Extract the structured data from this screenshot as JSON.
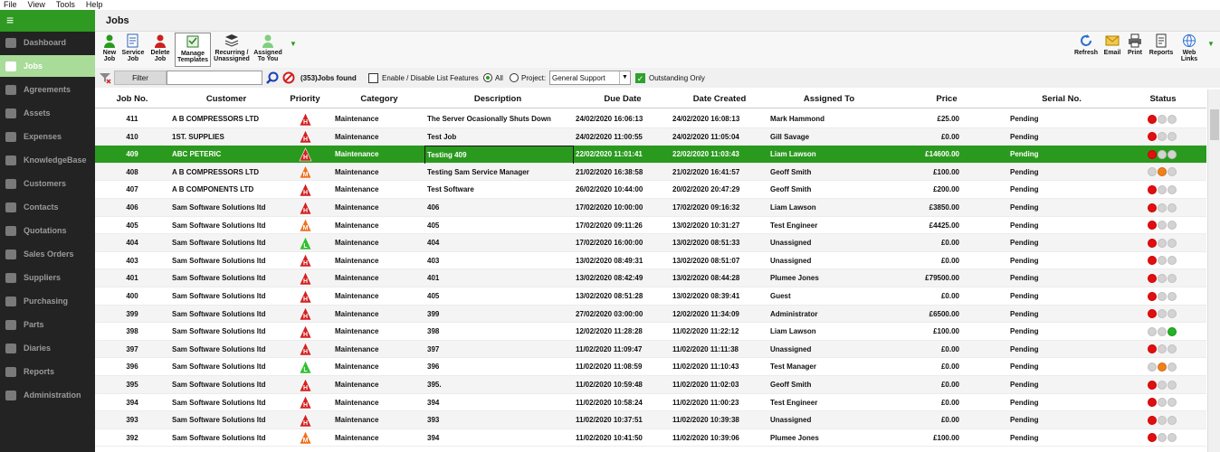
{
  "menu": [
    "File",
    "View",
    "Tools",
    "Help"
  ],
  "sidebar": {
    "toggle_glyph": "≡",
    "items": [
      {
        "label": "Dashboard",
        "icon": "dashboard-icon"
      },
      {
        "label": "Jobs",
        "icon": "pencil-icon",
        "active": true
      },
      {
        "label": "Agreements",
        "icon": "agreements-icon"
      },
      {
        "label": "Assets",
        "icon": "excel-icon"
      },
      {
        "label": "Expenses",
        "icon": "expenses-icon"
      },
      {
        "label": "KnowledgeBase",
        "icon": "knowledgebase-icon"
      },
      {
        "label": "Customers",
        "icon": "person-icon"
      },
      {
        "label": "Contacts",
        "icon": "phone-icon"
      },
      {
        "label": "Quotations",
        "icon": "quotation-icon"
      },
      {
        "label": "Sales Orders",
        "icon": "sales-icon"
      },
      {
        "label": "Suppliers",
        "icon": "box-icon"
      },
      {
        "label": "Purchasing",
        "icon": "purchasing-icon"
      },
      {
        "label": "Parts",
        "icon": "parts-icon"
      },
      {
        "label": "Diaries",
        "icon": "calendar-icon"
      },
      {
        "label": "Reports",
        "icon": "reports-icon"
      },
      {
        "label": "Administration",
        "icon": "wrench-icon"
      }
    ]
  },
  "page": {
    "title": "Jobs"
  },
  "toolbar": {
    "left": [
      {
        "label1": "New",
        "label2": "Job",
        "icon": "new-job-icon"
      },
      {
        "label1": "Service",
        "label2": "Job",
        "icon": "service-job-icon"
      },
      {
        "label1": "Delete",
        "label2": "Job",
        "icon": "delete-job-icon"
      },
      {
        "label1": "Manage",
        "label2": "Templates",
        "icon": "templates-icon"
      },
      {
        "label1": "Recurring /",
        "label2": "Unassigned",
        "icon": "recurring-icon"
      },
      {
        "label1": "Assigned",
        "label2": "To You",
        "icon": "assigned-icon"
      }
    ],
    "right": [
      {
        "label1": "Refresh",
        "label2": "",
        "icon": "refresh-icon"
      },
      {
        "label1": "Email",
        "label2": "",
        "icon": "email-icon"
      },
      {
        "label1": "Print",
        "label2": "",
        "icon": "print-icon"
      },
      {
        "label1": "Reports",
        "label2": "",
        "icon": "reports-icon"
      },
      {
        "label1": "Web",
        "label2": "Links",
        "icon": "web-links-icon"
      }
    ]
  },
  "filter": {
    "button": "Filter",
    "search_value": "",
    "jobs_found": "(353)Jobs found",
    "list_features": "Enable / Disable List Features",
    "radio_all": "All",
    "radio_project": "Project:",
    "project_value": "General Support",
    "outstanding": "Outstanding Only"
  },
  "table": {
    "headers": [
      "Job No.",
      "Customer",
      "Priority",
      "Category",
      "Description",
      "Due Date",
      "Date Created",
      "Assigned To",
      "Price",
      "Serial No.",
      "Status"
    ],
    "rows": [
      {
        "job": "411",
        "customer": "A B COMPRESSORS LTD",
        "priority": "H",
        "category": "Maintenance",
        "description": "The Server Ocasionally Shuts Down",
        "due": "24/02/2020 16:06:13",
        "created": "24/02/2020 16:08:13",
        "assigned": "Mark Hammond",
        "price": "£25.00",
        "serial": "Pending",
        "status": [
          "red",
          "grey",
          "grey"
        ]
      },
      {
        "job": "410",
        "customer": "1ST. SUPPLIES",
        "priority": "H",
        "category": "Maintenance",
        "description": "Test Job",
        "due": "24/02/2020 11:00:55",
        "created": "24/02/2020 11:05:04",
        "assigned": "Gill Savage",
        "price": "£0.00",
        "serial": "Pending",
        "status": [
          "red",
          "grey",
          "grey"
        ]
      },
      {
        "job": "409",
        "customer": "ABC PETERIC",
        "priority": "H",
        "category": "Maintenance",
        "description": "Testing 409",
        "due": "22/02/2020 11:01:41",
        "created": "22/02/2020 11:03:43",
        "assigned": "Liam Lawson",
        "price": "£14600.00",
        "serial": "Pending",
        "status": [
          "red",
          "grey",
          "grey"
        ],
        "selected": true
      },
      {
        "job": "408",
        "customer": "A B COMPRESSORS LTD",
        "priority": "M",
        "category": "Maintenance",
        "description": "Testing Sam Service Manager",
        "due": "21/02/2020 16:38:58",
        "created": "21/02/2020 16:41:57",
        "assigned": "Geoff Smith",
        "price": "£100.00",
        "serial": "Pending",
        "status": [
          "grey",
          "orange",
          "grey"
        ]
      },
      {
        "job": "407",
        "customer": "A B COMPONENTS LTD",
        "priority": "H",
        "category": "Maintenance",
        "description": "Test Software",
        "due": "26/02/2020 10:44:00",
        "created": "20/02/2020 20:47:29",
        "assigned": "Geoff Smith",
        "price": "£200.00",
        "serial": "Pending",
        "status": [
          "red",
          "grey",
          "grey"
        ]
      },
      {
        "job": "406",
        "customer": "Sam Software Solutions ltd",
        "priority": "H",
        "category": "Maintenance",
        "description": "406",
        "due": "17/02/2020 10:00:00",
        "created": "17/02/2020 09:16:32",
        "assigned": "Liam Lawson",
        "price": "£3850.00",
        "serial": "Pending",
        "status": [
          "red",
          "grey",
          "grey"
        ]
      },
      {
        "job": "405",
        "customer": "Sam Software Solutions ltd",
        "priority": "M",
        "category": "Maintenance",
        "description": "405",
        "due": "17/02/2020 09:11:26",
        "created": "13/02/2020 10:31:27",
        "assigned": "Test Engineer",
        "price": "£4425.00",
        "serial": "Pending",
        "status": [
          "red",
          "grey",
          "grey"
        ]
      },
      {
        "job": "404",
        "customer": "Sam Software Solutions ltd",
        "priority": "L",
        "category": "Maintenance",
        "description": "404",
        "due": "17/02/2020 16:00:00",
        "created": "13/02/2020 08:51:33",
        "assigned": "Unassigned",
        "price": "£0.00",
        "serial": "Pending",
        "status": [
          "red",
          "grey",
          "grey"
        ]
      },
      {
        "job": "403",
        "customer": "Sam Software Solutions ltd",
        "priority": "H",
        "category": "Maintenance",
        "description": "403",
        "due": "13/02/2020 08:49:31",
        "created": "13/02/2020 08:51:07",
        "assigned": "Unassigned",
        "price": "£0.00",
        "serial": "Pending",
        "status": [
          "red",
          "grey",
          "grey"
        ]
      },
      {
        "job": "401",
        "customer": "Sam Software Solutions ltd",
        "priority": "H",
        "category": "Maintenance",
        "description": "401",
        "due": "13/02/2020 08:42:49",
        "created": "13/02/2020 08:44:28",
        "assigned": "Plumee Jones",
        "price": "£79500.00",
        "serial": "Pending",
        "status": [
          "red",
          "grey",
          "grey"
        ]
      },
      {
        "job": "400",
        "customer": "Sam Software Solutions ltd",
        "priority": "H",
        "category": "Maintenance",
        "description": "405",
        "due": "13/02/2020 08:51:28",
        "created": "13/02/2020 08:39:41",
        "assigned": "Guest",
        "price": "£0.00",
        "serial": "Pending",
        "status": [
          "red",
          "grey",
          "grey"
        ]
      },
      {
        "job": "399",
        "customer": "Sam Software Solutions ltd",
        "priority": "H",
        "category": "Maintenance",
        "description": "399",
        "due": "27/02/2020 03:00:00",
        "created": "12/02/2020 11:34:09",
        "assigned": "Administrator",
        "price": "£6500.00",
        "serial": "Pending",
        "status": [
          "red",
          "grey",
          "grey"
        ]
      },
      {
        "job": "398",
        "customer": "Sam Software Solutions ltd",
        "priority": "H",
        "category": "Maintenance",
        "description": "398",
        "due": "12/02/2020 11:28:28",
        "created": "11/02/2020 11:22:12",
        "assigned": "Liam Lawson",
        "price": "£100.00",
        "serial": "Pending",
        "status": [
          "grey",
          "grey",
          "green"
        ]
      },
      {
        "job": "397",
        "customer": "Sam Software Solutions ltd",
        "priority": "H",
        "category": "Maintenance",
        "description": "397",
        "due": "11/02/2020 11:09:47",
        "created": "11/02/2020 11:11:38",
        "assigned": "Unassigned",
        "price": "£0.00",
        "serial": "Pending",
        "status": [
          "red",
          "grey",
          "grey"
        ]
      },
      {
        "job": "396",
        "customer": "Sam Software Solutions ltd",
        "priority": "L",
        "category": "Maintenance",
        "description": "396",
        "due": "11/02/2020 11:08:59",
        "created": "11/02/2020 11:10:43",
        "assigned": "Test Manager",
        "price": "£0.00",
        "serial": "Pending",
        "status": [
          "grey",
          "orange",
          "grey"
        ]
      },
      {
        "job": "395",
        "customer": "Sam Software Solutions ltd",
        "priority": "H",
        "category": "Maintenance",
        "description": "395.",
        "due": "11/02/2020 10:59:48",
        "created": "11/02/2020 11:02:03",
        "assigned": "Geoff Smith",
        "price": "£0.00",
        "serial": "Pending",
        "status": [
          "red",
          "grey",
          "grey"
        ]
      },
      {
        "job": "394",
        "customer": "Sam Software Solutions ltd",
        "priority": "H",
        "category": "Maintenance",
        "description": "394",
        "due": "11/02/2020 10:58:24",
        "created": "11/02/2020 11:00:23",
        "assigned": "Test Engineer",
        "price": "£0.00",
        "serial": "Pending",
        "status": [
          "red",
          "grey",
          "grey"
        ]
      },
      {
        "job": "393",
        "customer": "Sam Software Solutions ltd",
        "priority": "H",
        "category": "Maintenance",
        "description": "393",
        "due": "11/02/2020 10:37:51",
        "created": "11/02/2020 10:39:38",
        "assigned": "Unassigned",
        "price": "£0.00",
        "serial": "Pending",
        "status": [
          "red",
          "grey",
          "grey"
        ]
      },
      {
        "job": "392",
        "customer": "Sam Software Solutions ltd",
        "priority": "M",
        "category": "Maintenance",
        "description": "394",
        "due": "11/02/2020 10:41:50",
        "created": "11/02/2020 10:39:06",
        "assigned": "Plumee Jones",
        "price": "£100.00",
        "serial": "Pending",
        "status": [
          "red",
          "grey",
          "grey"
        ]
      }
    ]
  },
  "colors": {
    "accent": "#2a9a1e",
    "high": "#d42020",
    "medium": "#f07020",
    "low": "#30c030"
  }
}
